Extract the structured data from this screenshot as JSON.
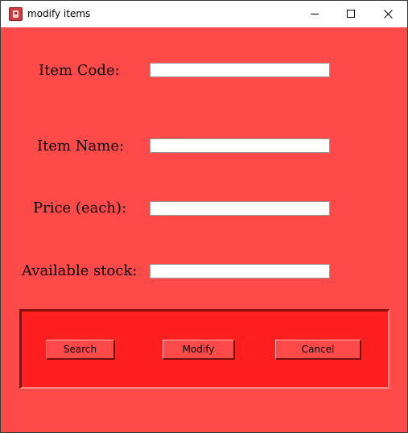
{
  "window": {
    "title": "modify items"
  },
  "titlebar_controls": {
    "minimize": "minimize-icon",
    "maximize": "maximize-icon",
    "close": "close-icon"
  },
  "form": {
    "item_code": {
      "label": "Item Code:",
      "value": ""
    },
    "item_name": {
      "label": "Item Name:",
      "value": ""
    },
    "price": {
      "label": "Price (each):",
      "value": ""
    },
    "stock": {
      "label": "Available stock:",
      "value": ""
    }
  },
  "buttons": {
    "search": "Search",
    "modify": "Modify",
    "cancel": "Cancel"
  },
  "colors": {
    "window_bg": "#ff4a4a",
    "panel_bg": "#ff1f1f"
  }
}
